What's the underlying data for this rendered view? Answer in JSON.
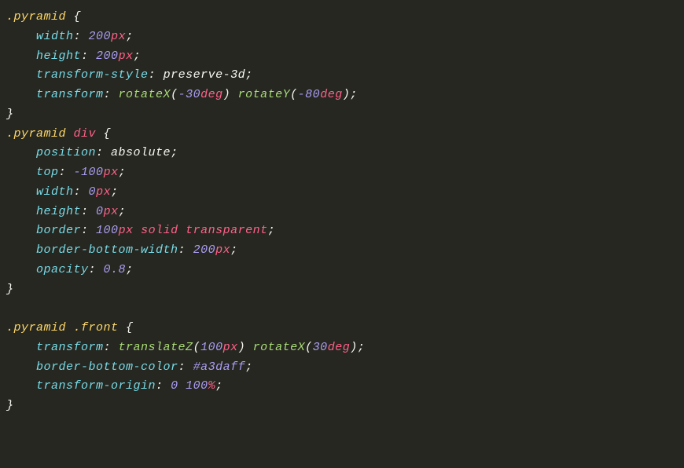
{
  "code": {
    "rules": [
      {
        "selectorParts": [
          {
            "kind": "sel",
            "text": ".pyramid"
          }
        ],
        "decls": [
          {
            "prop": "width",
            "tokens": [
              {
                "kind": "num",
                "text": "200"
              },
              {
                "kind": "unit",
                "text": "px"
              }
            ]
          },
          {
            "prop": "height",
            "tokens": [
              {
                "kind": "num",
                "text": "200"
              },
              {
                "kind": "unit",
                "text": "px"
              }
            ]
          },
          {
            "prop": "transform-style",
            "tokens": [
              {
                "kind": "kw-plain",
                "text": "preserve-3d"
              }
            ]
          },
          {
            "prop": "transform",
            "tokens": [
              {
                "kind": "func",
                "text": "rotateX"
              },
              {
                "kind": "punct",
                "text": "("
              },
              {
                "kind": "num",
                "text": "-30"
              },
              {
                "kind": "unit",
                "text": "deg"
              },
              {
                "kind": "punct",
                "text": ")"
              },
              {
                "kind": "plain",
                "text": " "
              },
              {
                "kind": "func",
                "text": "rotateY"
              },
              {
                "kind": "punct",
                "text": "("
              },
              {
                "kind": "num",
                "text": "-80"
              },
              {
                "kind": "unit",
                "text": "deg"
              },
              {
                "kind": "punct",
                "text": ")"
              }
            ]
          }
        ]
      },
      {
        "selectorParts": [
          {
            "kind": "sel",
            "text": ".pyramid"
          },
          {
            "kind": "plain",
            "text": " "
          },
          {
            "kind": "tag",
            "text": "div"
          }
        ],
        "decls": [
          {
            "prop": "position",
            "tokens": [
              {
                "kind": "kw-plain",
                "text": "absolute"
              }
            ]
          },
          {
            "prop": "top",
            "tokens": [
              {
                "kind": "num",
                "text": "-100"
              },
              {
                "kind": "unit",
                "text": "px"
              }
            ]
          },
          {
            "prop": "width",
            "tokens": [
              {
                "kind": "num",
                "text": "0"
              },
              {
                "kind": "unit",
                "text": "px"
              }
            ]
          },
          {
            "prop": "height",
            "tokens": [
              {
                "kind": "num",
                "text": "0"
              },
              {
                "kind": "unit",
                "text": "px"
              }
            ]
          },
          {
            "prop": "border",
            "tokens": [
              {
                "kind": "num",
                "text": "100"
              },
              {
                "kind": "unit",
                "text": "px"
              },
              {
                "kind": "plain",
                "text": " "
              },
              {
                "kind": "kw",
                "text": "solid"
              },
              {
                "kind": "plain",
                "text": " "
              },
              {
                "kind": "kw",
                "text": "transparent"
              }
            ]
          },
          {
            "prop": "border-bottom-width",
            "tokens": [
              {
                "kind": "num",
                "text": "200"
              },
              {
                "kind": "unit",
                "text": "px"
              }
            ]
          },
          {
            "prop": "opacity",
            "tokens": [
              {
                "kind": "num",
                "text": "0.8"
              }
            ]
          }
        ]
      },
      {
        "blankBefore": true,
        "selectorParts": [
          {
            "kind": "sel",
            "text": ".pyramid"
          },
          {
            "kind": "plain",
            "text": " "
          },
          {
            "kind": "sel",
            "text": ".front"
          }
        ],
        "decls": [
          {
            "prop": "transform",
            "tokens": [
              {
                "kind": "func",
                "text": "translateZ"
              },
              {
                "kind": "punct",
                "text": "("
              },
              {
                "kind": "num",
                "text": "100"
              },
              {
                "kind": "unit",
                "text": "px"
              },
              {
                "kind": "punct",
                "text": ")"
              },
              {
                "kind": "plain",
                "text": " "
              },
              {
                "kind": "func",
                "text": "rotateX"
              },
              {
                "kind": "punct",
                "text": "("
              },
              {
                "kind": "num",
                "text": "30"
              },
              {
                "kind": "unit",
                "text": "deg"
              },
              {
                "kind": "punct",
                "text": ")"
              }
            ]
          },
          {
            "prop": "border-bottom-color",
            "tokens": [
              {
                "kind": "num",
                "text": "#a3daff"
              }
            ]
          },
          {
            "prop": "transform-origin",
            "tokens": [
              {
                "kind": "num",
                "text": "0"
              },
              {
                "kind": "plain",
                "text": " "
              },
              {
                "kind": "num",
                "text": "100"
              },
              {
                "kind": "unit",
                "text": "%"
              }
            ]
          }
        ]
      }
    ]
  }
}
